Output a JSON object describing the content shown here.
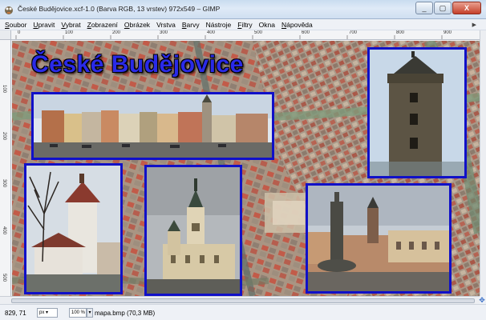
{
  "window": {
    "title": "České Budějovice.xcf-1.0 (Barva RGB, 13 vrstev) 972x549 – GIMP",
    "controls": [
      "_",
      "▢",
      "X"
    ]
  },
  "menu": {
    "items": [
      {
        "underline": "S",
        "rest": "oubor"
      },
      {
        "underline": "U",
        "rest": "pravit"
      },
      {
        "underline": "V",
        "rest": "ybrat"
      },
      {
        "underline": "Z",
        "rest": "obrazení"
      },
      {
        "underline": "O",
        "rest": "brázek"
      },
      {
        "underline": "",
        "rest": "Vrstva"
      },
      {
        "underline": "B",
        "rest": "arvy"
      },
      {
        "underline": "",
        "rest": "Nástroje"
      },
      {
        "underline": "F",
        "rest": "iltry"
      },
      {
        "underline": "",
        "rest": "Okna"
      },
      {
        "underline": "N",
        "rest": "ápověda"
      }
    ]
  },
  "rulers": {
    "horizontal": [
      "0",
      "100",
      "200",
      "300",
      "400",
      "500",
      "600",
      "700",
      "800",
      "900"
    ],
    "vertical": [
      "100",
      "200",
      "300",
      "400",
      "500"
    ]
  },
  "document": {
    "title": "České Budějovice"
  },
  "status": {
    "coords": "829, 71",
    "unit": "px",
    "zoom": "100 %",
    "message": "mapa.bmp (70,3 MB)"
  },
  "colors": {
    "frame": "#1010c8",
    "title_text": "#2a2ae8"
  }
}
